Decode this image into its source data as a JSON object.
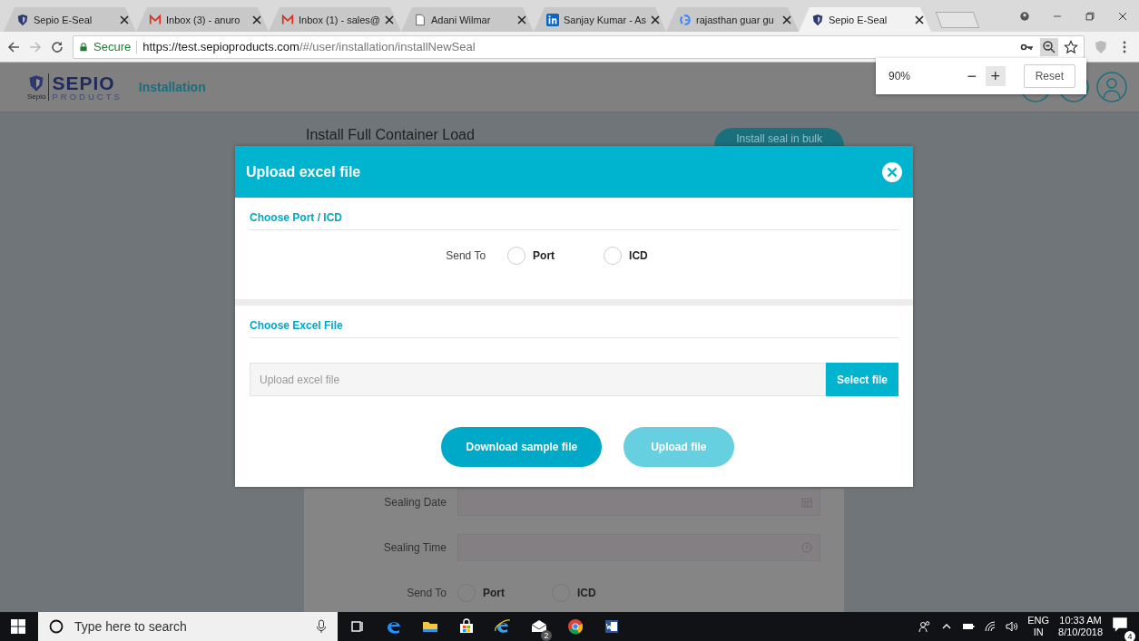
{
  "browser": {
    "tabs": [
      {
        "title": "Sepio E-Seal",
        "kind": "shield",
        "selected": false
      },
      {
        "title": "Inbox (3) - anuro",
        "kind": "gmail",
        "selected": false
      },
      {
        "title": "Inbox (1) - sales@",
        "kind": "gmail",
        "selected": false
      },
      {
        "title": "Adani Wilmar",
        "kind": "page",
        "selected": false
      },
      {
        "title": "Sanjay Kumar - As",
        "kind": "linkedin",
        "selected": false
      },
      {
        "title": "rajasthan guar gu",
        "kind": "google",
        "selected": false
      },
      {
        "title": "Sepio E-Seal",
        "kind": "shield",
        "selected": true
      }
    ],
    "secure_label": "Secure",
    "url_host": "https://test.sepioproducts.com",
    "url_path": "/#/user/installation/installNewSeal",
    "zoom_popup": {
      "value": "90%",
      "minus": "−",
      "plus": "+",
      "reset": "Reset"
    }
  },
  "app_header": {
    "logo_word": "SEPIO",
    "logo_sub": "PRODUCTS",
    "logo_mark": "Sepio",
    "section": "Installation"
  },
  "background_form": {
    "title": "Install Full Container Load",
    "bulk_button": "Install seal in bulk",
    "fields": [
      {
        "label": "Sealing Date",
        "kind": "date"
      },
      {
        "label": "Sealing Time",
        "kind": "time"
      }
    ],
    "send_to": {
      "label": "Send To",
      "options": [
        {
          "label": "Port",
          "selected": false
        },
        {
          "label": "ICD",
          "selected": false
        }
      ]
    }
  },
  "modal": {
    "title": "Upload excel file",
    "port_section": {
      "heading": "Choose Port / ICD",
      "label": "Send To",
      "options": [
        {
          "label": "Port",
          "selected": false
        },
        {
          "label": "ICD",
          "selected": false
        }
      ]
    },
    "file_section": {
      "heading": "Choose Excel File",
      "placeholder": "Upload excel file",
      "select_button": "Select file"
    },
    "buttons": [
      {
        "label": "Download sample file",
        "disabled": false
      },
      {
        "label": "Upload file",
        "disabled": true
      }
    ]
  },
  "taskbar": {
    "search_placeholder": "Type here to search",
    "apps": [
      {
        "kind": "taskview"
      },
      {
        "kind": "edge"
      },
      {
        "kind": "folder"
      },
      {
        "kind": "store"
      },
      {
        "kind": "ie"
      },
      {
        "kind": "mail",
        "badge": "2"
      },
      {
        "kind": "chrome"
      },
      {
        "kind": "word"
      }
    ],
    "language": "ENG",
    "region": "IN",
    "time": "10:33 AM",
    "date": "8/10/2018",
    "notifications": "4"
  }
}
